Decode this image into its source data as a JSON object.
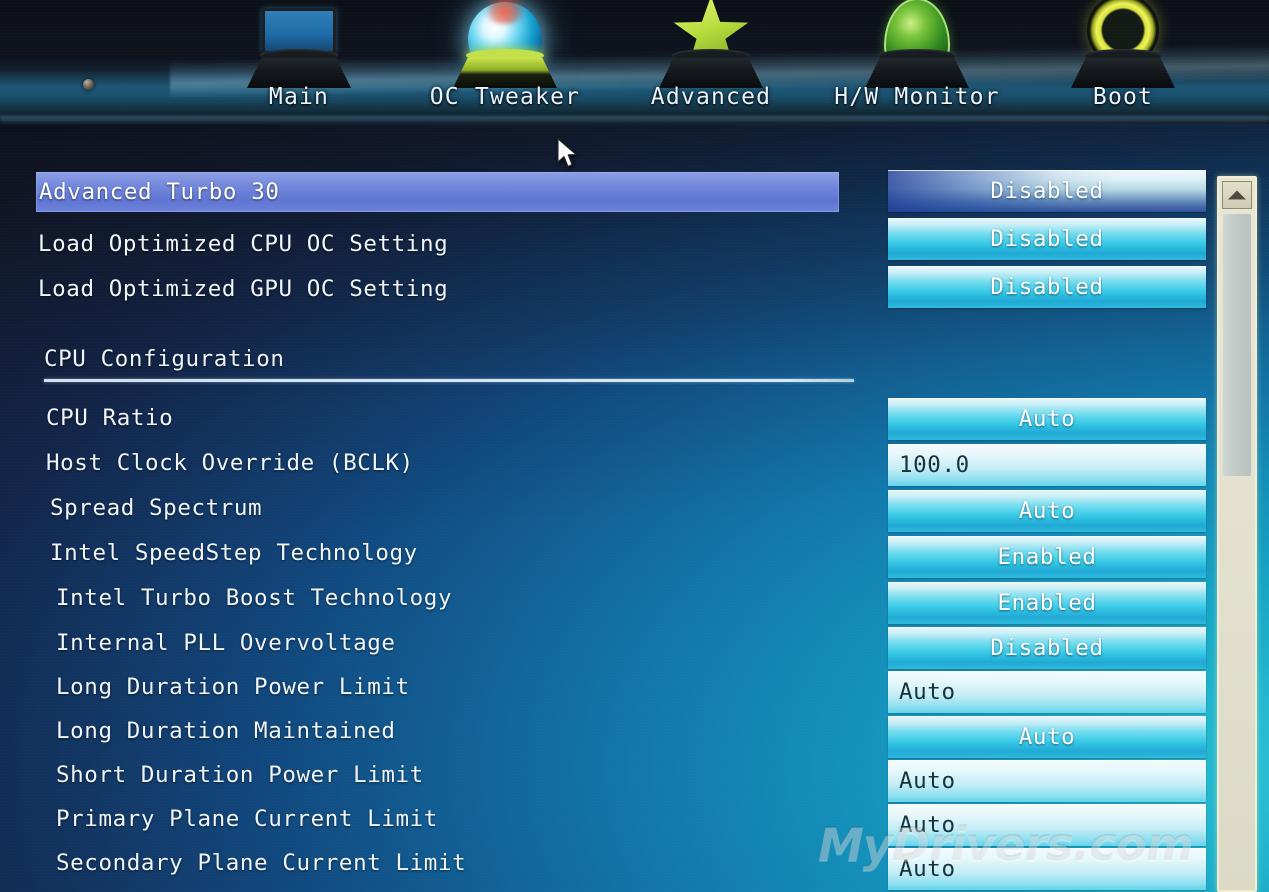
{
  "nav": {
    "items": [
      {
        "label": "Main",
        "icon": "monitor-icon",
        "active": false
      },
      {
        "label": "OC Tweaker",
        "icon": "orb-icon",
        "active": true
      },
      {
        "label": "Advanced",
        "icon": "star-icon",
        "active": false
      },
      {
        "label": "H/W Monitor",
        "icon": "dome-icon",
        "active": false
      },
      {
        "label": "Boot",
        "icon": "ring-icon",
        "active": false
      }
    ]
  },
  "menu": {
    "top_items": [
      {
        "label": "Advanced Turbo 30",
        "value": "Disabled",
        "control": "dropdown",
        "selected": true
      },
      {
        "label": "Load Optimized CPU OC Setting",
        "value": "Disabled",
        "control": "dropdown",
        "selected": false
      },
      {
        "label": "Load Optimized GPU OC Setting",
        "value": "Disabled",
        "control": "dropdown",
        "selected": false
      }
    ],
    "section": {
      "title": "CPU Configuration",
      "items": [
        {
          "label": "CPU Ratio",
          "value": "Auto",
          "control": "dropdown"
        },
        {
          "label": "Host Clock Override (BCLK)",
          "value": "100.0",
          "control": "textfield"
        },
        {
          "label": "Spread Spectrum",
          "value": "Auto",
          "control": "dropdown"
        },
        {
          "label": "Intel SpeedStep Technology",
          "value": "Enabled",
          "control": "dropdown"
        },
        {
          "label": "Intel Turbo Boost Technology",
          "value": "Enabled",
          "control": "dropdown"
        },
        {
          "label": "Internal PLL Overvoltage",
          "value": "Disabled",
          "control": "dropdown"
        },
        {
          "label": "Long Duration Power Limit",
          "value": "Auto",
          "control": "textfield"
        },
        {
          "label": "Long Duration Maintained",
          "value": "Auto",
          "control": "dropdown"
        },
        {
          "label": "Short Duration Power Limit",
          "value": "Auto",
          "control": "textfield"
        },
        {
          "label": "Primary Plane Current Limit",
          "value": "Auto",
          "control": "textfield"
        },
        {
          "label": "Secondary Plane Current Limit",
          "value": "Auto",
          "control": "textfield"
        }
      ]
    }
  },
  "scrollbar": {
    "up_arrow": "scroll-up-arrow-icon"
  },
  "watermark": {
    "text": "MyDrivers.com"
  },
  "colors": {
    "selection_blue": "#6d82d8",
    "value_cyan": "#35c8e6",
    "text_white": "#f1f6fa",
    "accent_lime": "#c3e04a",
    "scrollbar_cream": "#e3e0cf"
  }
}
